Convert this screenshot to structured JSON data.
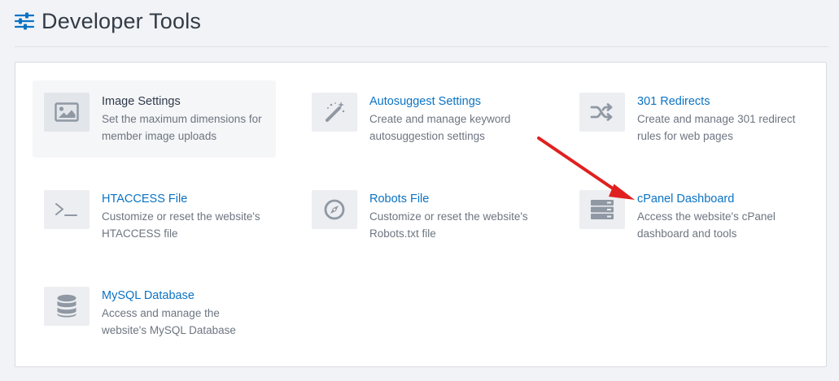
{
  "header": {
    "title": "Developer Tools",
    "icon": "sliders-icon"
  },
  "colors": {
    "link": "#0b73c4",
    "icon": "#8f98a3",
    "arrow": "#e02020"
  },
  "tools": [
    {
      "title": "Image Settings",
      "desc": "Set the maximum dimensions for member image uploads",
      "icon": "image-icon"
    },
    {
      "title": "Autosuggest Settings",
      "desc": "Create and manage keyword autosuggestion settings",
      "icon": "magic-wand-icon"
    },
    {
      "title": "301 Redirects",
      "desc": "Create and manage 301 redirect rules for web pages",
      "icon": "shuffle-icon"
    },
    {
      "title": "HTACCESS File",
      "desc": "Customize or reset the website's HTACCESS file",
      "icon": "terminal-icon"
    },
    {
      "title": "Robots File",
      "desc": "Customize or reset the website's Robots.txt file",
      "icon": "compass-icon"
    },
    {
      "title": "cPanel Dashboard",
      "desc": "Access the website's cPanel dashboard and tools",
      "icon": "server-icon"
    },
    {
      "title": "MySQL Database",
      "desc": "Access and manage the website's MySQL Database",
      "icon": "database-icon"
    }
  ]
}
